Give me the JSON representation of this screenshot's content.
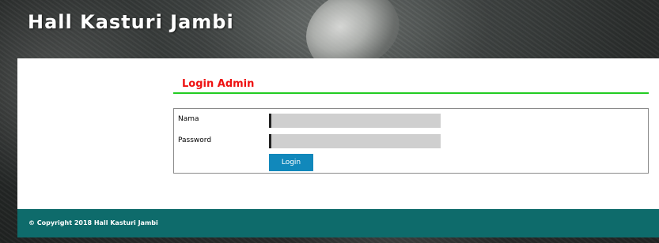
{
  "header": {
    "site_title": "Hall Kasturi Jambi"
  },
  "login": {
    "title": "Login Admin",
    "fields": {
      "nama_label": "Nama",
      "password_label": "Password",
      "nama_value": "",
      "password_value": ""
    },
    "button_label": "Login"
  },
  "footer": {
    "copyright": "© Copyright 2018 Hall Kasturi Jambi"
  },
  "colors": {
    "title_red": "#ee1111",
    "rule_green": "#22cc22",
    "button_blue": "#1188bb",
    "footer_teal": "#0e6b6b"
  }
}
